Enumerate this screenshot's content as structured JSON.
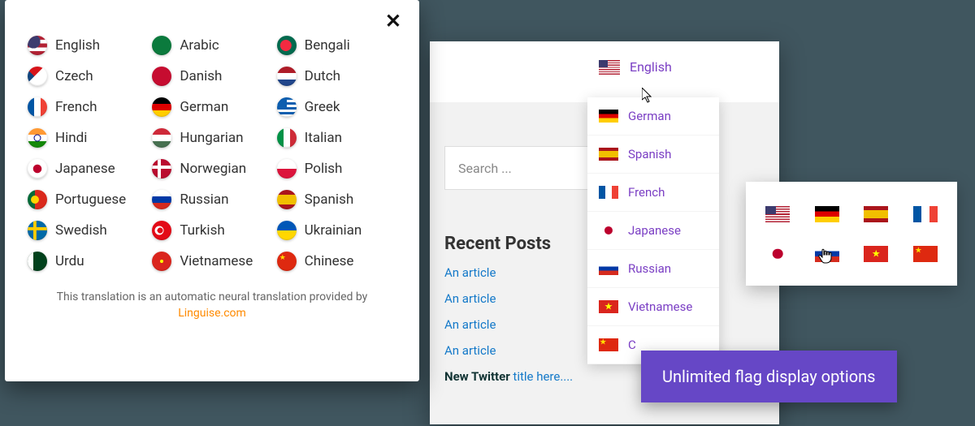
{
  "popup": {
    "languages": [
      {
        "label": "English",
        "flag": "cf-en"
      },
      {
        "label": "Arabic",
        "flag": "cf-ar"
      },
      {
        "label": "Bengali",
        "flag": "cf-bn"
      },
      {
        "label": "Czech",
        "flag": "cf-cz"
      },
      {
        "label": "Danish",
        "flag": "cf-da"
      },
      {
        "label": "Dutch",
        "flag": "cf-nl"
      },
      {
        "label": "French",
        "flag": "cf-fr"
      },
      {
        "label": "German",
        "flag": "cf-de"
      },
      {
        "label": "Greek",
        "flag": "cf-el"
      },
      {
        "label": "Hindi",
        "flag": "cf-hi"
      },
      {
        "label": "Hungarian",
        "flag": "cf-hu"
      },
      {
        "label": "Italian",
        "flag": "cf-it"
      },
      {
        "label": "Japanese",
        "flag": "cf-jp"
      },
      {
        "label": "Norwegian",
        "flag": "cf-no"
      },
      {
        "label": "Polish",
        "flag": "cf-pl"
      },
      {
        "label": "Portuguese",
        "flag": "cf-pt"
      },
      {
        "label": "Russian",
        "flag": "cf-ru"
      },
      {
        "label": "Spanish",
        "flag": "cf-es"
      },
      {
        "label": "Swedish",
        "flag": "cf-sv"
      },
      {
        "label": "Turkish",
        "flag": "cf-tr"
      },
      {
        "label": "Ukrainian",
        "flag": "cf-uk"
      },
      {
        "label": "Urdu",
        "flag": "cf-ur"
      },
      {
        "label": "Vietnamese",
        "flag": "cf-vi"
      },
      {
        "label": "Chinese",
        "flag": "cf-zh"
      }
    ],
    "footer_text": "This translation is an automatic neural translation provided by",
    "footer_link": "Linguise.com"
  },
  "site": {
    "search_placeholder": "Search ...",
    "recent_title": "Recent Posts",
    "recent_items": [
      "An article",
      "An article",
      "An article",
      "An article"
    ],
    "recent_new_prefix": "New Twitter",
    "recent_new_suffix": " title here...."
  },
  "dropdown": {
    "active": {
      "label": "English",
      "flag": "f-us"
    },
    "items": [
      {
        "label": "German",
        "flag": "f-de"
      },
      {
        "label": "Spanish",
        "flag": "f-es"
      },
      {
        "label": "French",
        "flag": "f-fr"
      },
      {
        "label": "Japanese",
        "flag": "f-jp"
      },
      {
        "label": "Russian",
        "flag": "f-ru"
      },
      {
        "label": "Vietnamese",
        "flag": "f-vn"
      },
      {
        "label": "C",
        "flag": "f-cn"
      }
    ]
  },
  "flag_panel": [
    "f-us",
    "f-de",
    "f-es",
    "f-fr",
    "f-jp",
    "f-ru",
    "f-vn",
    "f-cn"
  ],
  "tooltip": "Unlimited flag display options"
}
